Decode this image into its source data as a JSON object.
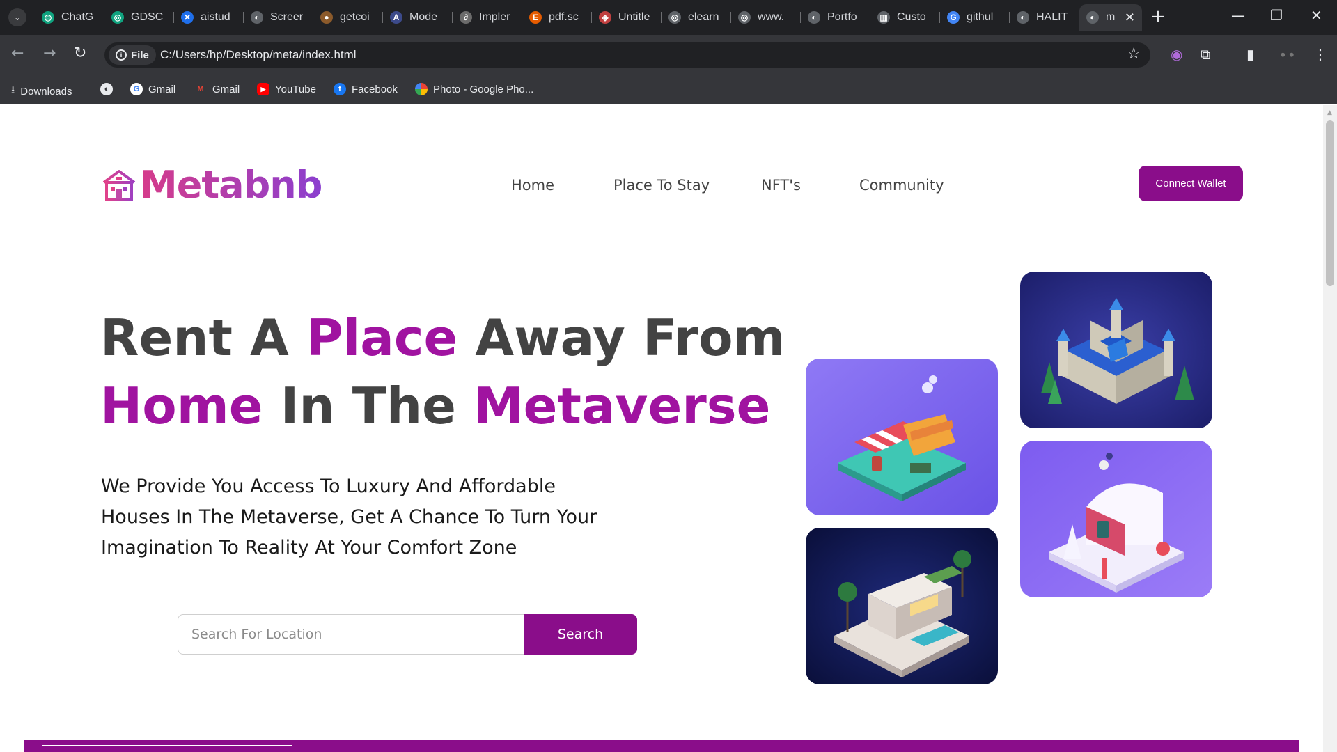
{
  "browser": {
    "tabs": [
      {
        "label": "ChatG",
        "icon": "chatgpt-icon",
        "color": "#10a37f"
      },
      {
        "label": "GDSC",
        "icon": "openai-icon",
        "color": "#10a37f"
      },
      {
        "label": "aistud",
        "icon": "x-logo-icon",
        "color": "#1f6feb"
      },
      {
        "label": "Screer",
        "icon": "globe-icon",
        "color": "#5f6368"
      },
      {
        "label": "getcoi",
        "icon": "avatar-icon",
        "color": "#8b5a2b"
      },
      {
        "label": "Mode",
        "icon": "a-logo-icon",
        "color": "#3c4a8a"
      },
      {
        "label": "Impler",
        "icon": "link-icon",
        "color": "#6b6b6b"
      },
      {
        "label": "pdf.sc",
        "icon": "e-logo-icon",
        "color": "#e65c00"
      },
      {
        "label": "Untitle",
        "icon": "figma-icon",
        "color": "#c04040"
      },
      {
        "label": "elearn",
        "icon": "openai-icon",
        "color": "#5f6368"
      },
      {
        "label": "www.",
        "icon": "openai-icon",
        "color": "#5f6368"
      },
      {
        "label": "Portfo",
        "icon": "globe-icon",
        "color": "#5f6368"
      },
      {
        "label": "Custo",
        "icon": "audio-icon",
        "color": "#5f6368"
      },
      {
        "label": "githul",
        "icon": "google-icon",
        "color": "#4285f4"
      },
      {
        "label": "HALIT",
        "icon": "globe-icon",
        "color": "#5f6368"
      },
      {
        "label": "m",
        "icon": "globe-icon",
        "color": "#5f6368",
        "active": true
      }
    ],
    "address": {
      "scheme_chip": "File",
      "url": "C:/Users/hp/Desktop/meta/index.html"
    },
    "bookmarks": [
      {
        "label": "Downloads",
        "icon": "download-icon",
        "color": "#e8eaed"
      },
      {
        "label": "",
        "icon": "globe-icon",
        "color": "#e8eaed"
      },
      {
        "label": "Gmail",
        "icon": "google-icon",
        "color": "#4285f4"
      },
      {
        "label": "Gmail",
        "icon": "gmail-icon",
        "color": "#ea4335"
      },
      {
        "label": "YouTube",
        "icon": "youtube-icon",
        "color": "#ff0000"
      },
      {
        "label": "Facebook",
        "icon": "facebook-icon",
        "color": "#1877f2"
      },
      {
        "label": "Photo - Google Pho...",
        "icon": "google-photos-icon",
        "color": "#fbbc04"
      }
    ]
  },
  "site": {
    "logo_text": "Metabnb",
    "nav": [
      "Home",
      "Place To Stay",
      "NFT's",
      "Community"
    ],
    "connect_wallet": "Connect Wallet",
    "headline": {
      "l1_a": "Rent A ",
      "l1_b": "Place",
      "l1_c": " Away From",
      "l2_a": "Home",
      "l2_b": " In The ",
      "l2_c": "Metaverse"
    },
    "subtext": "We Provide You Access To Luxury And Affordable Houses In The Metaverse, Get A Chance To Turn Your Imagination To Reality At Your Comfort Zone",
    "search": {
      "placeholder": "Search For Location",
      "button": "Search"
    },
    "colors": {
      "brand": "#8a0d8a",
      "headline_accent": "#a013a0",
      "text": "#434343"
    }
  }
}
